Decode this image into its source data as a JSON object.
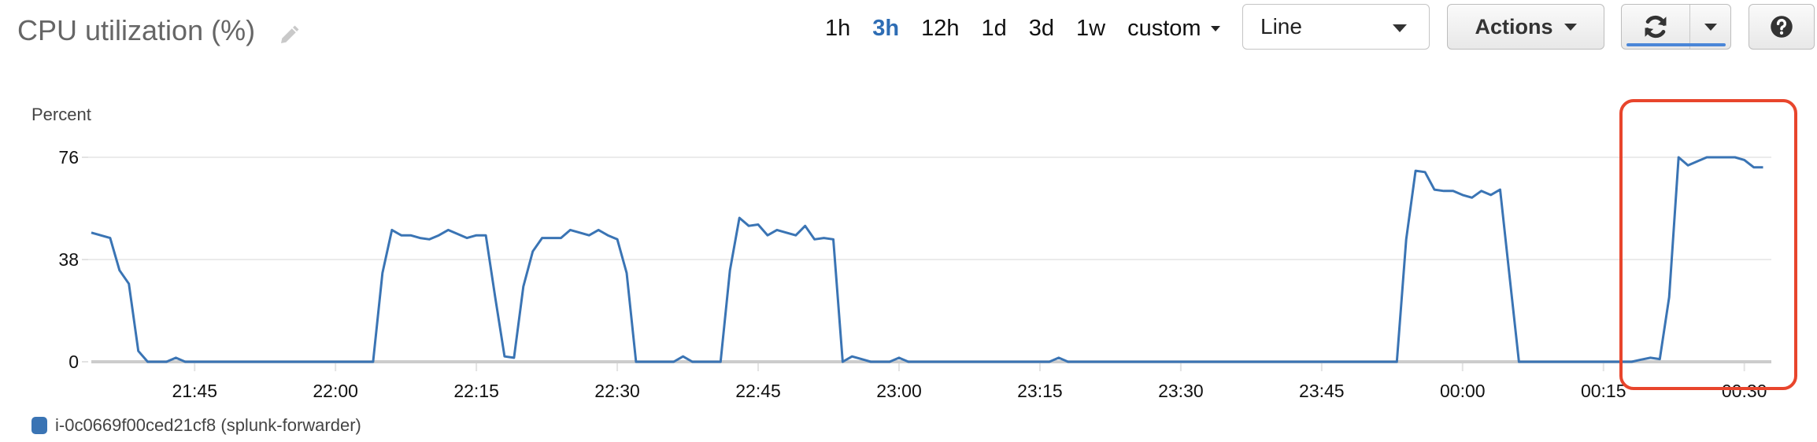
{
  "header": {
    "title": "CPU utilization (%)",
    "edit_icon": "pencil-icon",
    "time_ranges": [
      {
        "label": "1h",
        "active": false
      },
      {
        "label": "3h",
        "active": true
      },
      {
        "label": "12h",
        "active": false
      },
      {
        "label": "1d",
        "active": false
      },
      {
        "label": "3d",
        "active": false
      },
      {
        "label": "1w",
        "active": false
      }
    ],
    "custom_label": "custom",
    "chart_type_select": {
      "value": "Line"
    },
    "actions_label": "Actions",
    "refresh_icon": "refresh-icon",
    "help_icon": "help-icon"
  },
  "colors": {
    "series": "#3a74b4",
    "active_range": "#2e6db4",
    "annotation": "#e8452c",
    "refresh_progress": "#4a86d8"
  },
  "legend": [
    {
      "label": "i-0c0669f00ced21cf8 (splunk-forwarder)",
      "color": "#3a74b4"
    }
  ],
  "chart_data": {
    "type": "line",
    "title": "CPU utilization (%)",
    "xlabel": "",
    "ylabel": "Percent",
    "ylim": [
      0,
      76
    ],
    "yticks": [
      0,
      38,
      76
    ],
    "x_start": "21:34",
    "x_step_minutes": 1,
    "xticks": [
      "21:45",
      "22:00",
      "22:15",
      "22:30",
      "22:45",
      "23:00",
      "23:15",
      "23:30",
      "23:45",
      "00:00",
      "00:15",
      "00:30"
    ],
    "grid": true,
    "legend_position": "bottom-left",
    "annotation": {
      "type": "highlight-box",
      "range": [
        "00:18",
        "00:34"
      ]
    },
    "series": [
      {
        "name": "i-0c0669f00ced21cf8 (splunk-forwarder)",
        "values": [
          48,
          47,
          46,
          34,
          29,
          4,
          0,
          0,
          0,
          1.5,
          0,
          0,
          0,
          0,
          0,
          0,
          0,
          0,
          0,
          0,
          0,
          0,
          0,
          0,
          0,
          0,
          0,
          0,
          0,
          0,
          0,
          33,
          49,
          47,
          47,
          46,
          45.5,
          47,
          49,
          47.5,
          46,
          47,
          47,
          24,
          2,
          1.5,
          28,
          41,
          46,
          46,
          46,
          49,
          48,
          47,
          49,
          47,
          45.5,
          33,
          0,
          0,
          0,
          0,
          0,
          2,
          0,
          0,
          0,
          0,
          34,
          53.5,
          50.5,
          51,
          47,
          49,
          48,
          47,
          50.5,
          45.5,
          46,
          45.5,
          0,
          2,
          1,
          0,
          0,
          0,
          1.5,
          0,
          0,
          0,
          0,
          0,
          0,
          0,
          0,
          0,
          0,
          0,
          0,
          0,
          0,
          0,
          0,
          1.5,
          0,
          0,
          0,
          0,
          0,
          0,
          0,
          0,
          0,
          0,
          0,
          0,
          0,
          0,
          0,
          0,
          0,
          0,
          0,
          0,
          0,
          0,
          0,
          0,
          0,
          0,
          0,
          0,
          0,
          0,
          0,
          0,
          0,
          0,
          0,
          0,
          45.5,
          71,
          70.5,
          64,
          63.5,
          63.5,
          62,
          61,
          63.5,
          62,
          64,
          32,
          0,
          0,
          0,
          0,
          0,
          0,
          0,
          0,
          0,
          0,
          0,
          0,
          0,
          0.8,
          1.5,
          1,
          24,
          76,
          73,
          74.5,
          76,
          76,
          76,
          76,
          75,
          72.3,
          72.3
        ]
      }
    ]
  }
}
